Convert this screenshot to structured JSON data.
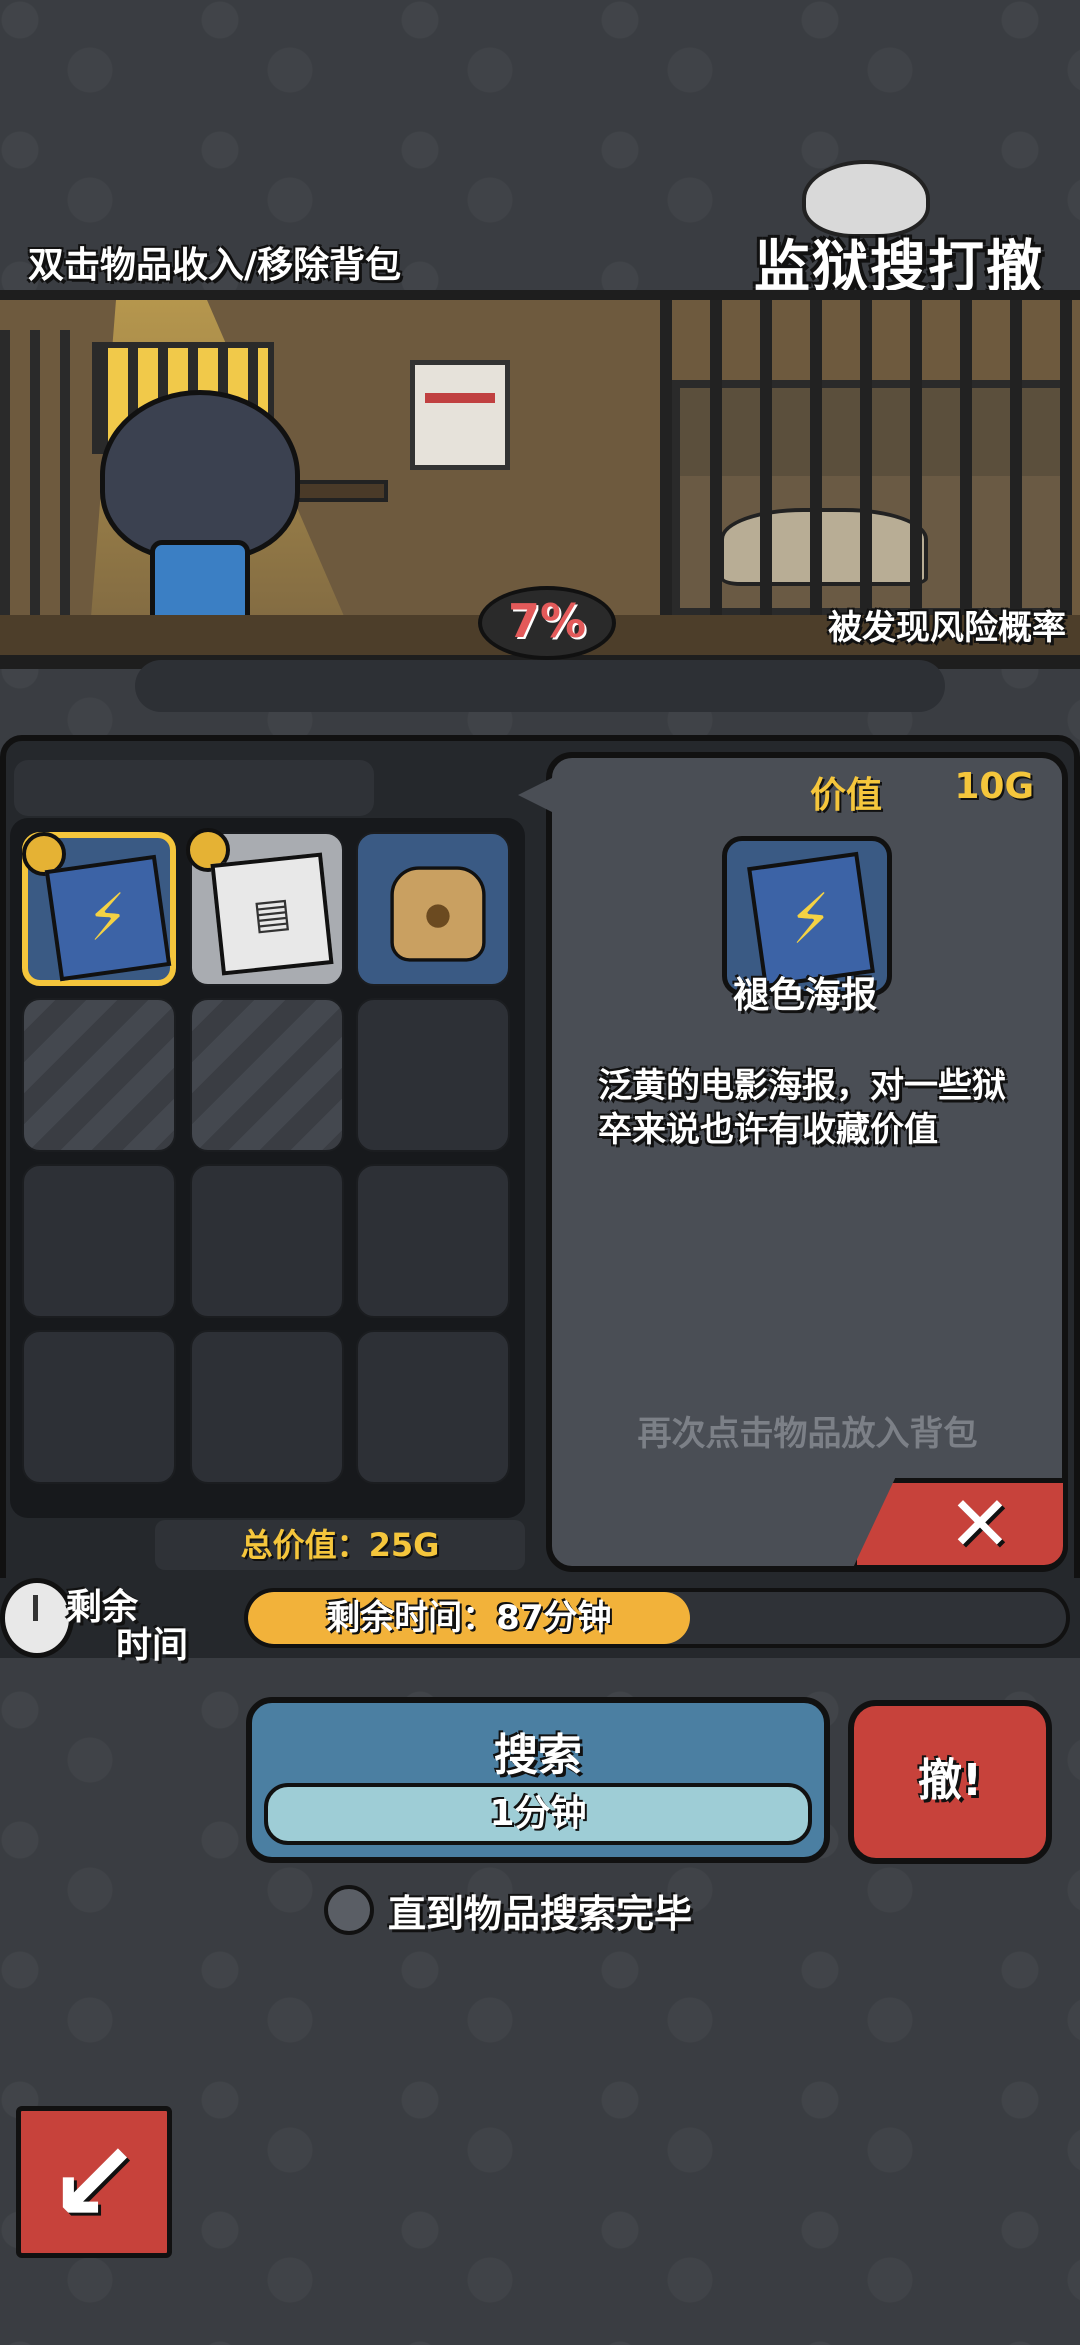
{
  "header": {
    "hint": "双击物品收入/移除背包",
    "title": "监狱搜打撤"
  },
  "risk": {
    "percent": "7%",
    "label": "被发现风险概率"
  },
  "inventory": {
    "slots": [
      {
        "state": "filled",
        "item": "poster",
        "selected": true,
        "coin": true
      },
      {
        "state": "gray",
        "item": "magazine",
        "selected": false,
        "coin": true
      },
      {
        "state": "filled",
        "item": "bread",
        "selected": false,
        "coin": false
      },
      {
        "state": "locked"
      },
      {
        "state": "locked"
      },
      {
        "state": "empty"
      },
      {
        "state": "empty"
      },
      {
        "state": "empty"
      },
      {
        "state": "empty"
      },
      {
        "state": "empty"
      },
      {
        "state": "empty"
      },
      {
        "state": "empty"
      }
    ],
    "total_value": "总价值：25G"
  },
  "detail": {
    "value_label": "价值",
    "value": "10G",
    "item_name": "褪色海报",
    "description": "泛黄的电影海报，对一些狱卒来说也许有收藏价值",
    "hint": "再次点击物品放入背包",
    "close_icon": "close-icon"
  },
  "timer": {
    "label_line1": "剩余",
    "label_line2": "时间",
    "text": "剩余时间：87分钟",
    "progress_fraction": 0.54
  },
  "actions": {
    "search_label": "搜索",
    "search_duration": "1分钟",
    "escape_label": "撤!",
    "auto_search_label": "直到物品搜索完毕"
  },
  "colors": {
    "accent_gold": "#f5c63c",
    "danger_red": "#c7423b",
    "search_blue": "#4b7fa2"
  }
}
